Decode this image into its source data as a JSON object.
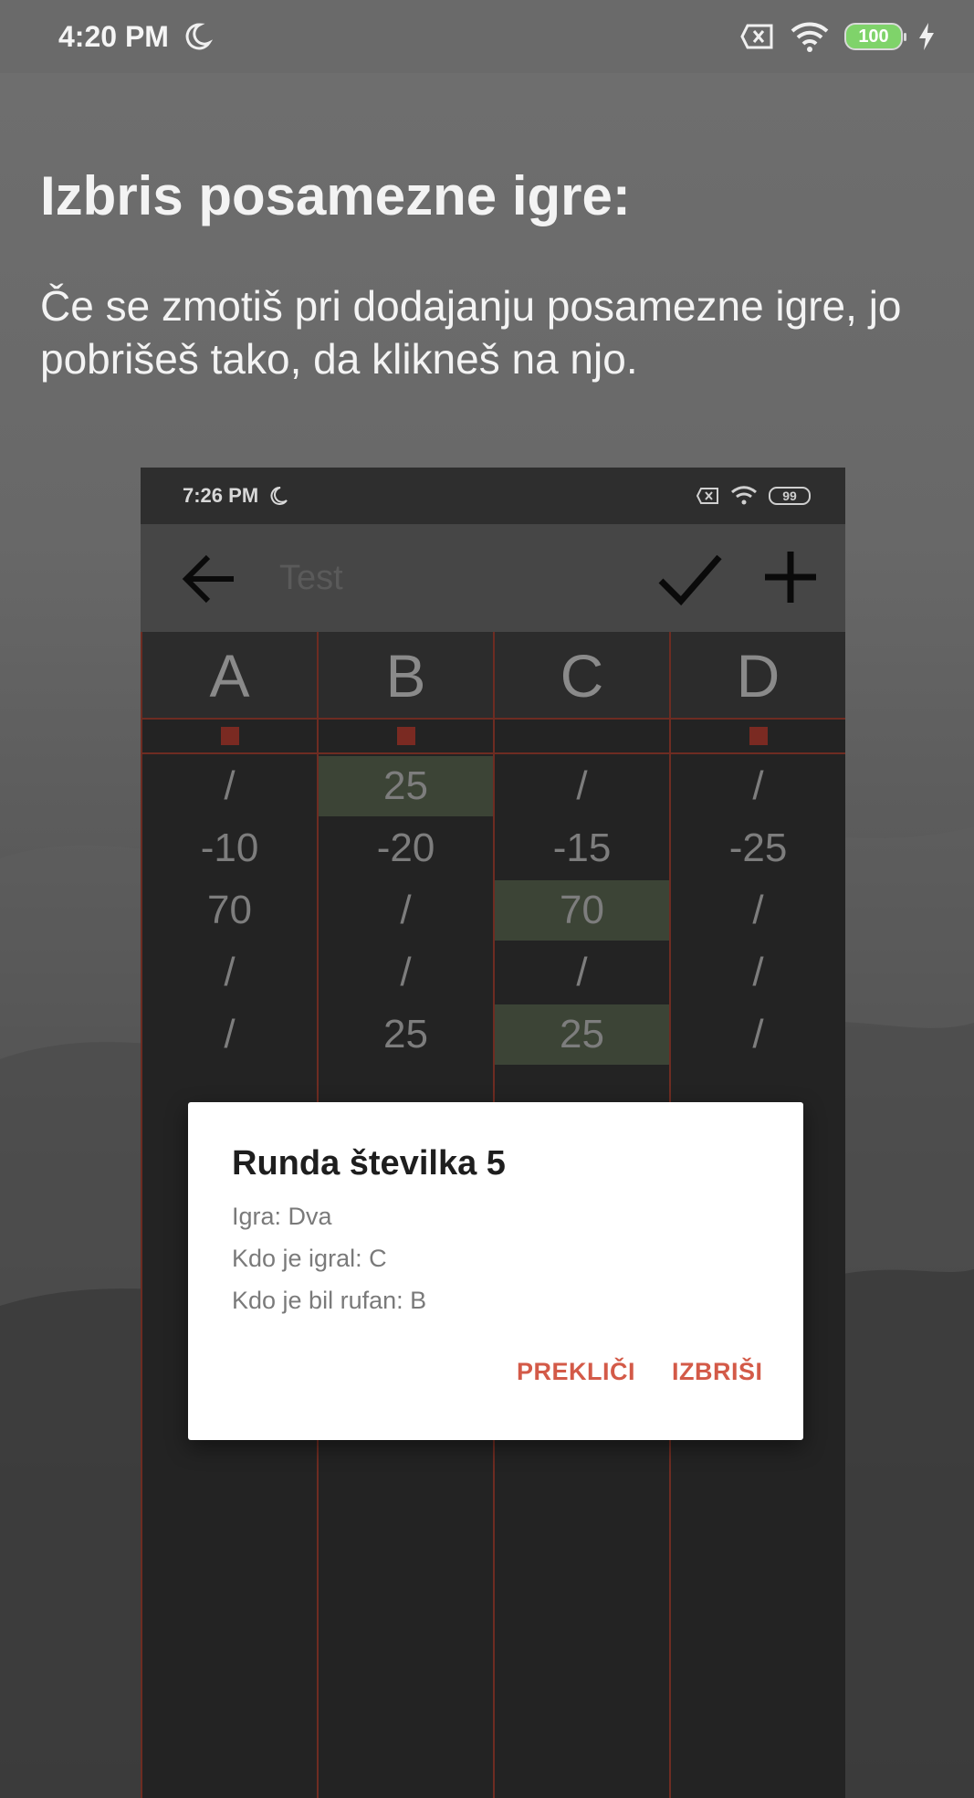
{
  "status_bar": {
    "time": "4:20 PM",
    "battery": "100",
    "icons": [
      "moon-icon",
      "sim-off-icon",
      "wifi-icon",
      "battery-icon",
      "charging-bolt-icon"
    ]
  },
  "heading": "Izbris posamezne igre:",
  "description": "Če se zmotiš pri dodajanju posamezne igre, jo pobrišeš tako, da klikneš na njo.",
  "screenshot": {
    "status": {
      "time": "7:26 PM",
      "battery": "99"
    },
    "toolbar": {
      "title": "Test"
    },
    "columns": [
      {
        "name": "A",
        "marker": true,
        "cells": [
          "/",
          "-10",
          "70",
          "/",
          "/"
        ]
      },
      {
        "name": "B",
        "marker": true,
        "cells": [
          "25",
          "-20",
          "/",
          "/",
          "25"
        ]
      },
      {
        "name": "C",
        "marker": false,
        "cells": [
          "/",
          "-15",
          "70",
          "/",
          "25"
        ]
      },
      {
        "name": "D",
        "marker": true,
        "cells": [
          "/",
          "-25",
          "/",
          "/",
          "/"
        ]
      }
    ],
    "highlighted": [
      [
        1,
        0
      ],
      [
        2,
        2
      ],
      [
        2,
        4
      ]
    ],
    "colors": {
      "grid_line": "#6e2c22",
      "highlight": "#3c4436",
      "dialog_button": "#d35a48",
      "battery_fill": "#7fd36a"
    },
    "dialog": {
      "title": "Runda številka 5",
      "lines": [
        "Igra: Dva",
        "Kdo je igral: C",
        "Kdo je bil rufan: B"
      ],
      "cancel_label": "PREKLIČI",
      "delete_label": "IZBRIŠI"
    }
  }
}
